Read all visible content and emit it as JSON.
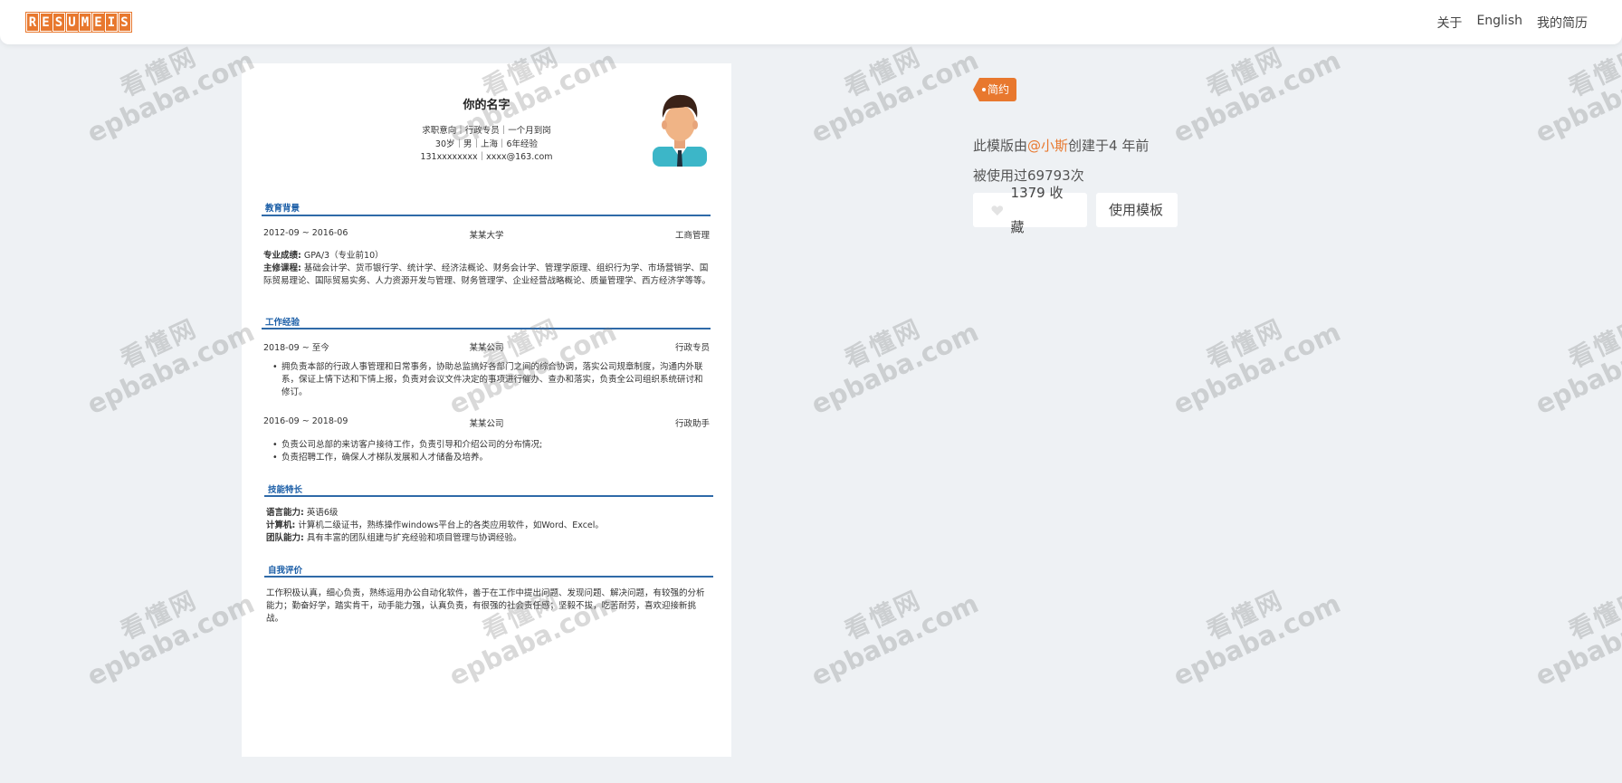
{
  "header": {
    "logo_letters": [
      "R",
      "E",
      "S",
      "U",
      "M",
      "E",
      "I",
      "S"
    ],
    "nav": [
      {
        "label": "关于"
      },
      {
        "label": "English"
      },
      {
        "label": "我的简历"
      }
    ]
  },
  "watermark": {
    "cn": "看懂网",
    "en": "epbaba.com"
  },
  "resume": {
    "name": "你的名字",
    "line1": "求职意向｜行政专员｜一个月到岗",
    "line2": "30岁｜男｜上海｜6年经验",
    "line3": "131xxxxxxxx｜xxxx@163.com",
    "education": {
      "title": "教育背景",
      "date": "2012-09 ~ 2016-06",
      "school": "某某大学",
      "major": "工商管理",
      "gpa_label": "专业成绩:",
      "gpa_value": " GPA/3（专业前10）",
      "courses_label": "主修课程:",
      "courses_value": " 基础会计学、货币银行学、统计学、经济法概论、财务会计学、管理学原理、组织行为学、市场营销学、国际贸易理论、国际贸易实务、人力资源开发与管理、财务管理学、企业经营战略概论、质量管理学、西方经济学等等。"
    },
    "work": {
      "title": "工作经验",
      "jobs": [
        {
          "date": "2018-09 ~ 至今",
          "company": "某某公司",
          "role": "行政专员",
          "bullets": [
            "拥负责本部的行政人事管理和日常事务，协助总监搞好各部门之间的综合协调，落实公司规章制度，沟通内外联系，保证上情下达和下情上报，负责对会议文件决定的事项进行催办、查办和落实，负责全公司组织系统研讨和修订。"
          ]
        },
        {
          "date": "2016-09 ~ 2018-09",
          "company": "某某公司",
          "role": "行政助手",
          "bullets": [
            "负责公司总部的来访客户接待工作，负责引导和介绍公司的分布情况;",
            "负责招聘工作，确保人才梯队发展和人才储备及培养。"
          ]
        }
      ]
    },
    "skills": {
      "title": "技能特长",
      "items": [
        {
          "label": "语言能力:",
          "value": " 英语6级"
        },
        {
          "label": "计算机:",
          "value": " 计算机二级证书，熟练操作windows平台上的各类应用软件，如Word、Excel。"
        },
        {
          "label": "团队能力:",
          "value": " 具有丰富的团队组建与扩充经验和项目管理与协调经验。"
        }
      ]
    },
    "self": {
      "title": "自我评价",
      "text": "工作积极认真，细心负责，熟练运用办公自动化软件，善于在工作中提出问题、发现问题、解决问题，有较强的分析能力；勤奋好学，踏实肯干，动手能力强，认真负责，有很强的社会责任感；坚毅不拔，吃苦耐劳，喜欢迎接新挑战。"
    }
  },
  "info": {
    "tag": "简约",
    "created_prefix": "此模版由",
    "author": "@小斯",
    "created_suffix": "创建于4 年前",
    "used": "被使用过69793次",
    "fav_label": "1379 收藏",
    "use_label": "使用模板"
  },
  "colors": {
    "accent": "#e8782e",
    "section_blue": "#1b5ea7",
    "background": "#eef1f4"
  }
}
